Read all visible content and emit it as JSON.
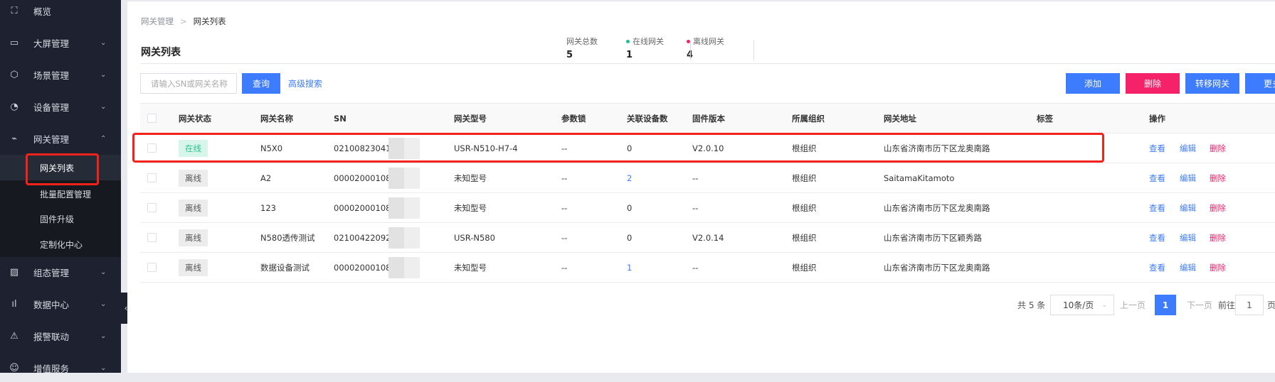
{
  "sidebar": {
    "items": [
      {
        "label": "概览",
        "icon": "scan-icon",
        "chevron": ""
      },
      {
        "label": "大屏管理",
        "icon": "monitor-icon",
        "chevron": "⌄"
      },
      {
        "label": "场景管理",
        "icon": "cube-icon",
        "chevron": "⌄"
      },
      {
        "label": "设备管理",
        "icon": "pie-icon",
        "chevron": "⌄"
      },
      {
        "label": "网关管理",
        "icon": "pulse-icon",
        "chevron": "⌃"
      },
      {
        "label": "组态管理",
        "icon": "image-icon",
        "chevron": "⌄"
      },
      {
        "label": "数据中心",
        "icon": "bar-chart-icon",
        "chevron": "⌄"
      },
      {
        "label": "报警联动",
        "icon": "alarm-icon",
        "chevron": "⌄"
      },
      {
        "label": "增值服务",
        "icon": "service-icon",
        "chevron": "⌄"
      }
    ],
    "submenu": [
      "网关列表",
      "批量配置管理",
      "固件升级",
      "定制化中心"
    ],
    "collapse": "‹"
  },
  "breadcrumb": {
    "parent": "网关管理",
    "sep": ">",
    "current": "网关列表"
  },
  "title": "网关列表",
  "stats": [
    {
      "label": "网关总数",
      "value": "5",
      "dot": ""
    },
    {
      "label": "在线网关",
      "value": "1",
      "dot": "#1ec08f"
    },
    {
      "label": "离线网关",
      "value": "4",
      "dot": "#f5226a"
    }
  ],
  "search": {
    "placeholder": "请输入SN或网关名称",
    "query": "查询",
    "advanced": "高级搜索"
  },
  "actions": {
    "add": "添加",
    "delete": "删除",
    "transfer": "转移网关",
    "more": "更多"
  },
  "colors": {
    "primary": "#3d7bff",
    "danger": "#f5226a",
    "online": "#2ec38a",
    "highlight": "#f5221b"
  },
  "table": {
    "headers": [
      "网关状态",
      "网关名称",
      "SN",
      "网关型号",
      "参数锁",
      "关联设备数",
      "固件版本",
      "所属组织",
      "网关地址",
      "标签",
      "操作"
    ],
    "rows": [
      {
        "status": "在线",
        "online": true,
        "name": "N5X0",
        "sn": "02100823041300",
        "model": "USR-N510-H7-4",
        "lock": "--",
        "devices": "0",
        "devLink": false,
        "fw": "V2.0.10",
        "org": "根组织",
        "addr": "山东省济南市历下区龙奥南路",
        "tag": ""
      },
      {
        "status": "离线",
        "online": false,
        "name": "A2",
        "sn": "00002000108927",
        "model": "未知型号",
        "lock": "--",
        "devices": "2",
        "devLink": true,
        "fw": "--",
        "org": "根组织",
        "addr": "SaitamaKitamoto",
        "tag": ""
      },
      {
        "status": "离线",
        "online": false,
        "name": "123",
        "sn": "00002000108927",
        "model": "未知型号",
        "lock": "--",
        "devices": "0",
        "devLink": false,
        "fw": "--",
        "org": "根组织",
        "addr": "山东省济南市历下区龙奥南路",
        "tag": ""
      },
      {
        "status": "离线",
        "online": false,
        "name": "N580透传测试",
        "sn": "02100422092100",
        "model": "USR-N580",
        "lock": "--",
        "devices": "0",
        "devLink": false,
        "fw": "V2.0.14",
        "org": "根组织",
        "addr": "山东省济南市历下区颖秀路",
        "tag": ""
      },
      {
        "status": "离线",
        "online": false,
        "name": "数据设备测试",
        "sn": "00002000108927",
        "model": "未知型号",
        "lock": "--",
        "devices": "1",
        "devLink": true,
        "fw": "--",
        "org": "根组织",
        "addr": "山东省济南市历下区龙奥南路",
        "tag": ""
      }
    ],
    "ops": {
      "view": "查看",
      "edit": "编辑",
      "delete": "删除"
    }
  },
  "pagination": {
    "total": "共 5 条",
    "pageSize": "10条/页",
    "prev": "上一页",
    "current": "1",
    "next": "下一页",
    "goto": "前往",
    "gotoValue": "1",
    "pageUnit": "页"
  }
}
